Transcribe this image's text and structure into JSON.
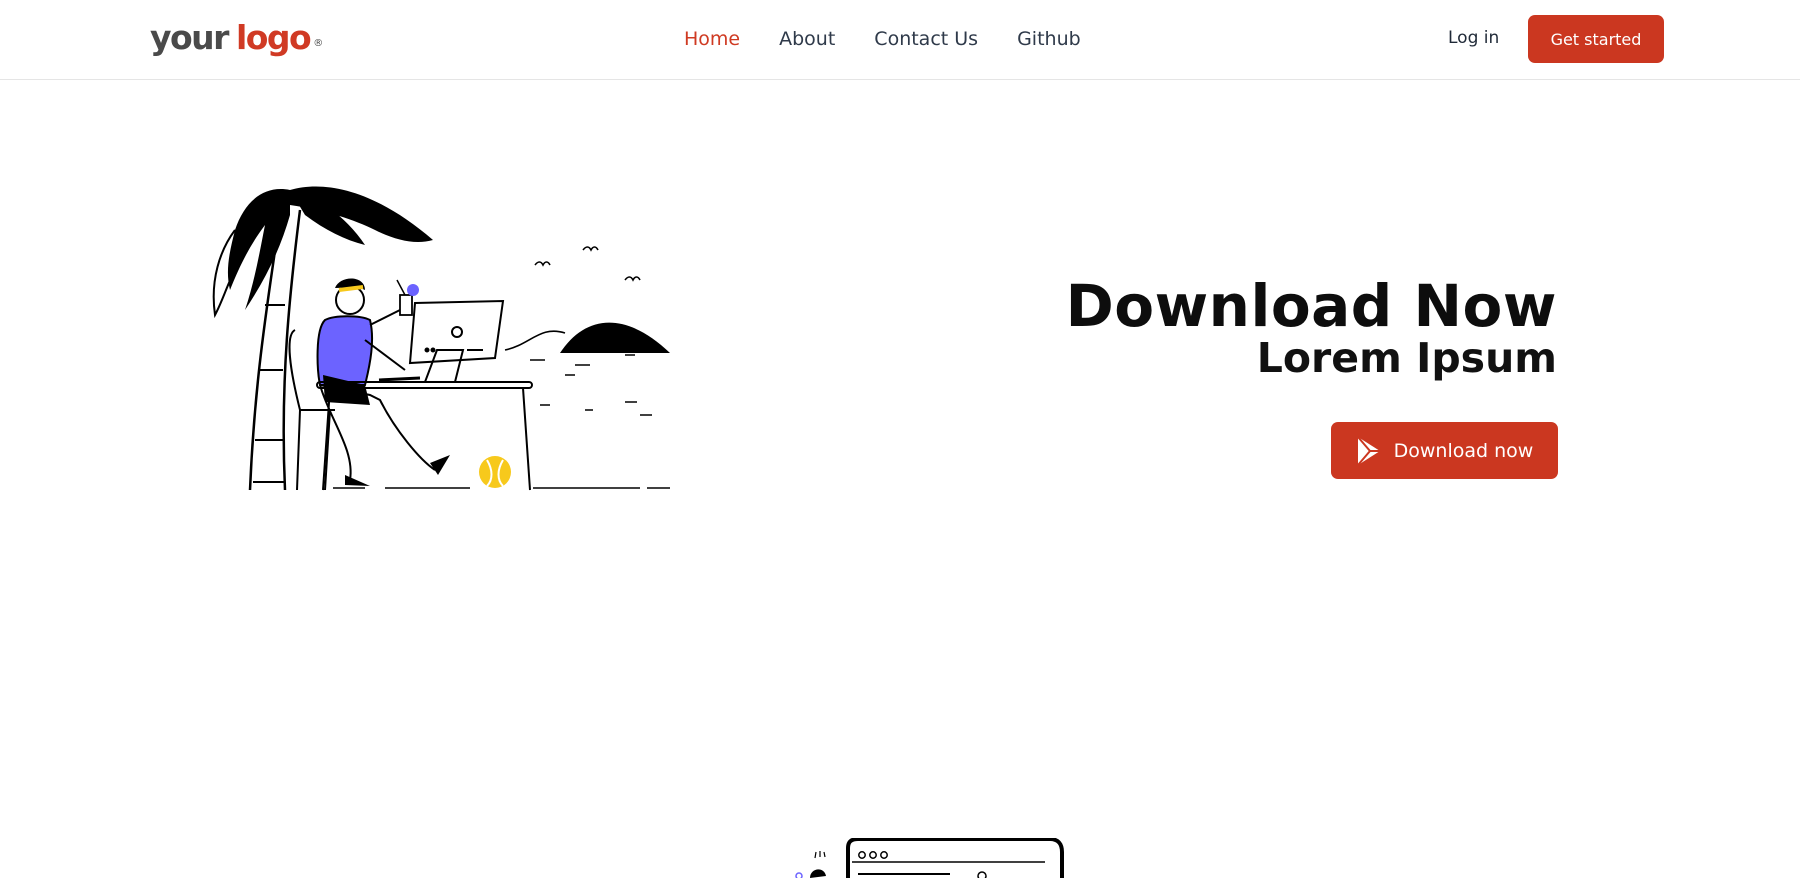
{
  "header": {
    "logo": {
      "word1": "your",
      "word2": "logo",
      "mark": "®"
    },
    "nav": [
      {
        "label": "Home",
        "active": true
      },
      {
        "label": "About",
        "active": false
      },
      {
        "label": "Contact Us",
        "active": false
      },
      {
        "label": "Github",
        "active": false
      }
    ],
    "login_label": "Log in",
    "cta_label": "Get started"
  },
  "hero": {
    "title": "Download Now",
    "subtitle": "Lorem Ipsum",
    "download_label": "Download now",
    "download_icon": "play-store-icon"
  },
  "colors": {
    "accent": "#cb3720",
    "nav_text": "#2f3a4a",
    "shirt": "#6c63ff",
    "ball": "#f7c91c"
  }
}
